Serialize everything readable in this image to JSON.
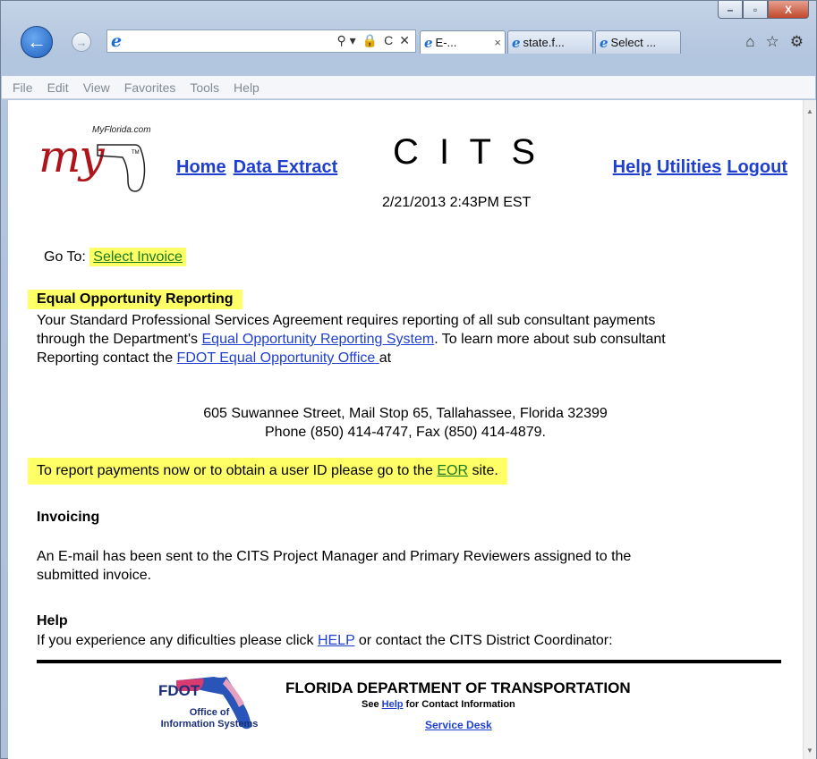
{
  "window": {
    "controls": {
      "minimize": "–",
      "maximize": "▫",
      "close": "X"
    }
  },
  "nav": {
    "back_glyph": "←",
    "forward_glyph": "→",
    "address_tools": [
      "⚲ ▾",
      "🔒",
      "C",
      "✕"
    ],
    "tabs": [
      {
        "label": "E-...",
        "close": "×",
        "active": true
      },
      {
        "label": "state.f...",
        "close": "",
        "active": false
      },
      {
        "label": "Select ...",
        "close": "",
        "active": false
      }
    ],
    "right_icons": [
      "⌂",
      "☆",
      "⚙"
    ]
  },
  "menubar": [
    "File",
    "Edit",
    "View",
    "Favorites",
    "Tools",
    "Help"
  ],
  "header": {
    "logo_small": "MyFlorida.com",
    "logo_big": "my",
    "title": "C I T S",
    "timestamp": "2/21/2013   2:43PM EST",
    "left_links": [
      "Home",
      "Data Extract"
    ],
    "right_links": [
      "Help",
      "Utilities",
      "Logout"
    ]
  },
  "goto": {
    "prefix": "Go To:",
    "link": "Select Invoice"
  },
  "eor": {
    "heading": "Equal Opportunity Reporting",
    "line1": "Your Standard Professional Services Agreement requires reporting of all sub consultant payments",
    "line2_pre": "through the Department's ",
    "line2_link": "Equal Opportunity Reporting System",
    "line2_post": ".  To learn more about sub consultant",
    "line3_pre": "Reporting contact the ",
    "line3_link": "FDOT Equal Opportunity Office ",
    "line3_post": " at",
    "address1": "605 Suwannee Street, Mail Stop 65, Tallahassee, Florida 32399",
    "address2": "Phone (850) 414-4747, Fax (850) 414-4879.",
    "report_pre": "To report payments now or to obtain a user ID please go to the ",
    "report_link": "EOR",
    "report_post": " site."
  },
  "invoicing": {
    "heading": "Invoicing",
    "text1": "An E-mail has been sent to the CITS Project Manager and Primary Reviewers assigned to the",
    "text2": "submitted invoice."
  },
  "help": {
    "heading": "Help",
    "pre": "If you experience any dificulties please click ",
    "link": "HELP",
    "post": " or contact the CITS District Coordinator:"
  },
  "footer": {
    "logo_text": "FDOT",
    "logo_sub1": "Office of",
    "logo_sub2": "Information Systems",
    "title": "FLORIDA DEPARTMENT OF TRANSPORTATION",
    "sub_pre": "See ",
    "sub_link": "Help",
    "sub_post": " for Contact Information",
    "desk_link": "Service Desk"
  },
  "colors": {
    "link": "#1f3fcf",
    "highlight": "#ffff66",
    "logo_red": "#b0141b"
  }
}
